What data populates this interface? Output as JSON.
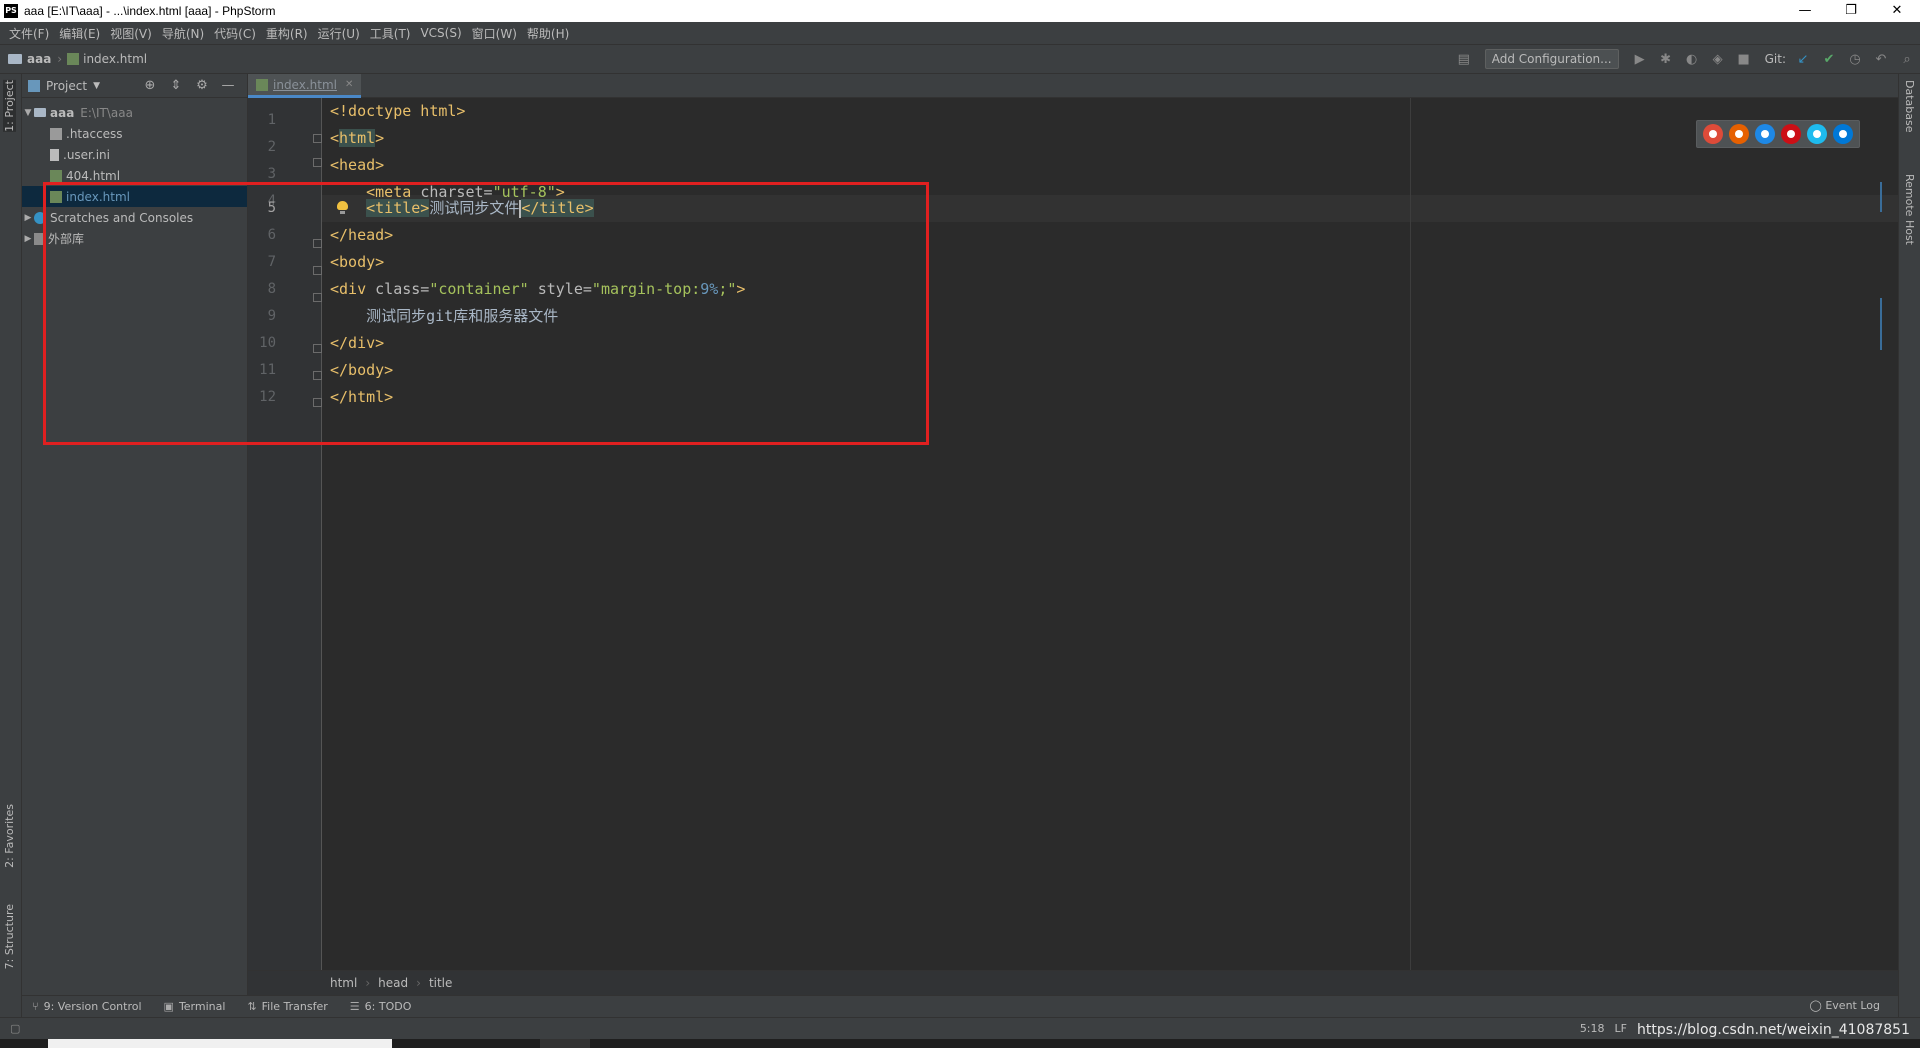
{
  "window": {
    "title": "aaa [E:\\IT\\aaa] - ...\\index.html [aaa] - PhpStorm",
    "logo": "PS",
    "controls": [
      "—",
      "❐",
      "✕"
    ]
  },
  "menu": [
    "文件(F)",
    "编辑(E)",
    "视图(V)",
    "导航(N)",
    "代码(C)",
    "重构(R)",
    "运行(U)",
    "工具(T)",
    "VCS(S)",
    "窗口(W)",
    "帮助(H)"
  ],
  "nav": {
    "project": "aaa",
    "separator": "›",
    "file": "index.html",
    "add_config": "Add Configuration...",
    "git_label": "Git:"
  },
  "left_strip": {
    "project": "1: Project",
    "favorites": "2: Favorites",
    "structure": "7: Structure"
  },
  "right_strip": {
    "database": "Database",
    "remote_host": "Remote Host"
  },
  "project_panel": {
    "title": "Project",
    "tree": [
      {
        "label": "aaa",
        "path": "E:\\IT\\aaa"
      },
      {
        "label": ".htaccess"
      },
      {
        "label": ".user.ini"
      },
      {
        "label": "404.html"
      },
      {
        "label": "index.html"
      },
      {
        "label": "Scratches and Consoles"
      },
      {
        "label": "外部库"
      }
    ]
  },
  "editor": {
    "tab": "index.html",
    "line_numbers": [
      "1",
      "2",
      "3",
      "4",
      "5",
      "6",
      "7",
      "8",
      "9",
      "10",
      "11",
      "12"
    ],
    "code": {
      "l1": "<!doctype html>",
      "l2_open": "<",
      "l2_tag": "html",
      "l2_close": ">",
      "l3": "<head>",
      "l4_tag": "<meta ",
      "l4_attr": "charset=",
      "l4_val": "\"utf-8\"",
      "l4_end": ">",
      "l5_open": "<title>",
      "l5_text": "测试同步文件",
      "l5_close": "</title>",
      "l6": "</head>",
      "l7": "<body>",
      "l8_tag": "<div ",
      "l8_attr1": "class=",
      "l8_val1": "\"container\"",
      "l8_attr2": " style=",
      "l8_q1": "\"",
      "l8_prop": "margin-top:",
      "l8_num": "9%",
      "l8_semi": ";",
      "l8_q2": "\"",
      "l8_end": ">",
      "l9": "测试同步git库和服务器文件",
      "l10": "</div>",
      "l11": "</body>",
      "l12": "</html>"
    },
    "breadcrumbs": [
      "html",
      "head",
      "title"
    ]
  },
  "tool_windows": [
    {
      "icon": "⑂",
      "label": "9: Version Control"
    },
    {
      "icon": "▣",
      "label": "Terminal"
    },
    {
      "icon": "⇅",
      "label": "File Transfer"
    },
    {
      "icon": "☰",
      "label": "6: TODO"
    }
  ],
  "event_log": "Event Log",
  "status": {
    "position": "5:18",
    "line_sep": "LF",
    "watermark": "https://blog.csdn.net/weixin_41087851"
  },
  "colors": {
    "accent": "#4a88c7",
    "highlight_box": "#e02020",
    "tag": "#e8bf6a",
    "string": "#a5c25c"
  }
}
